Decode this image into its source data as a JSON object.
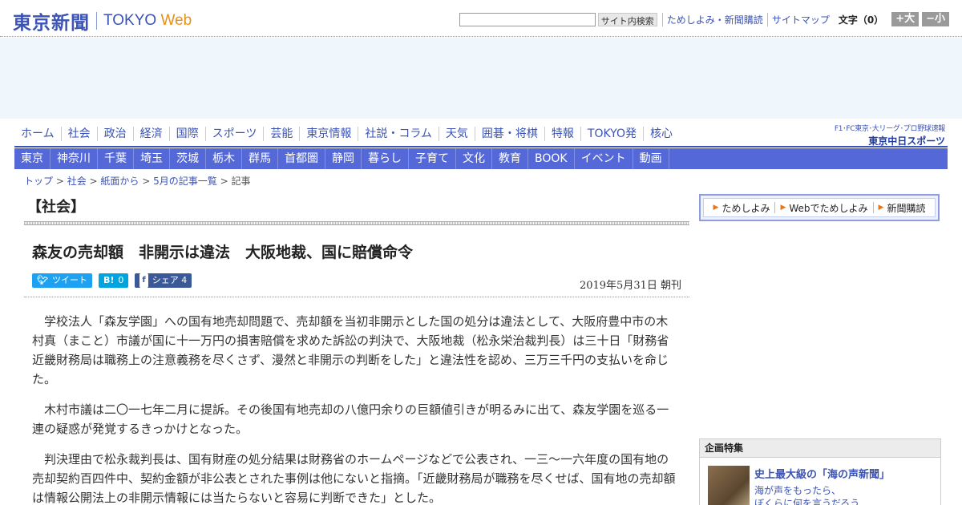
{
  "header": {
    "logo_jp": "東京新聞",
    "logo_en": "TOKYO",
    "logo_web": "Web",
    "search_button": "サイト内検索",
    "links": [
      "ためしよみ・新聞購読",
      "サイトマップ"
    ],
    "font_size_label": "文字（0）",
    "font_plus": "+大",
    "font_minus": "−小"
  },
  "nav_main": [
    "ホーム",
    "社会",
    "政治",
    "経済",
    "国際",
    "スポーツ",
    "芸能",
    "東京情報",
    "社説・コラム",
    "天気",
    "囲碁・将棋",
    "特報",
    "TOKYO発",
    "核心"
  ],
  "chunichi": {
    "line1": "F1･FC東京･大リーグ･プロ野球速報",
    "line2": "東京中日スポーツ"
  },
  "nav_region": [
    "東京",
    "神奈川",
    "千葉",
    "埼玉",
    "茨城",
    "栃木",
    "群馬",
    "首都圏",
    "静岡",
    "暮らし",
    "子育て",
    "文化",
    "教育",
    "BOOK",
    "イベント",
    "動画"
  ],
  "breadcrumb": [
    "トップ",
    "社会",
    "紙面から",
    "5月の記事一覧",
    "記事"
  ],
  "article": {
    "section": "【社会】",
    "headline": "森友の売却額　非開示は違法　大阪地裁、国に賠償命令",
    "tweet_label": "ツイート",
    "hatena_label": "B!",
    "hatena_count": "0",
    "share_label": "シェア",
    "share_count": "4",
    "date": "2019年5月31日 朝刊",
    "paragraphs": [
      "学校法人「森友学園」への国有地売却問題で、売却額を当初非開示とした国の処分は違法として、大阪府豊中市の木村真（まこと）市議が国に十一万円の損害賠償を求めた訴訟の判決で、大阪地裁（松永栄治裁判長）は三十日「財務省近畿財務局は職務上の注意義務を尽くさず、漫然と非開示の判断をした」と違法性を認め、三万三千円の支払いを命じた。",
      "木村市議は二〇一七年二月に提訴。その後国有地売却の八億円余りの巨額値引きが明るみに出て、森友学園を巡る一連の疑惑が発覚するきっかけとなった。",
      "判決理由で松永裁判長は、国有財産の処分結果は財務省のホームページなどで公表され、一三～一六年度の国有地の売却契約百四件中、契約金額が非公表とされた事例は他にないと指摘。「近畿財務局が職務を尽くせば、国有地の売却額は情報公開法上の非開示情報には当たらないと容易に判断できた」とした。"
    ]
  },
  "sidebar": {
    "promo": [
      "ためしよみ",
      "Webでためしよみ",
      "新聞購読"
    ],
    "feature_header": "企画特集",
    "feature_title": "史上最大級の「海の声新聞」",
    "feature_sub1": "海が声をもったら、",
    "feature_sub2": "ぼくらに何を言うだろう"
  }
}
